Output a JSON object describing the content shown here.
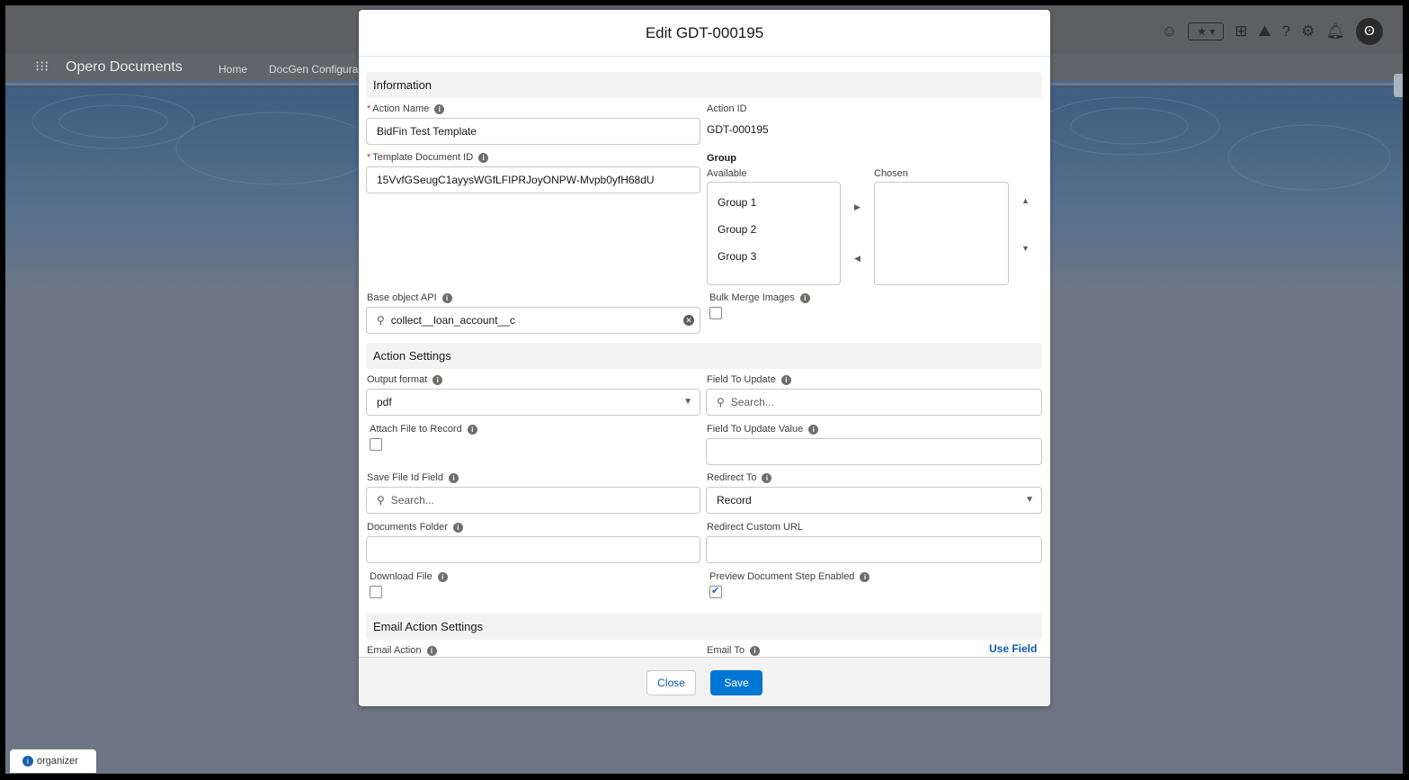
{
  "app": {
    "name": "Opero Documents",
    "nav": [
      "Home",
      "DocGen Configura"
    ]
  },
  "utility_icons": [
    "gear-face-icon",
    "favorites-icon",
    "add-icon",
    "trailhead-icon",
    "help-icon",
    "setup-icon",
    "notifications-icon",
    "avatar-icon"
  ],
  "organizer": {
    "label": "organizer"
  },
  "modal": {
    "title": "Edit GDT-000195",
    "sections": {
      "information": "Information",
      "action_settings": "Action Settings",
      "email_action_settings": "Email Action Settings"
    },
    "fields": {
      "action_name": {
        "label": "Action Name",
        "value": "BidFin Test Template"
      },
      "action_id": {
        "label": "Action ID",
        "value": "GDT-000195"
      },
      "template_document_id": {
        "label": "Template Document ID",
        "value": "15VvfGSeugC1ayysWGfLFIPRJoyONPW-Mvpb0yfH68dU"
      },
      "group": {
        "label": "Group",
        "available_label": "Available",
        "chosen_label": "Chosen",
        "available": [
          "Group 1",
          "Group 2",
          "Group 3"
        ],
        "chosen": []
      },
      "base_object_api": {
        "label": "Base object API",
        "value": "collect__loan_account__c"
      },
      "bulk_merge_images": {
        "label": "Bulk Merge Images",
        "checked": false
      },
      "output_format": {
        "label": "Output format",
        "value": "pdf"
      },
      "field_to_update": {
        "label": "Field To Update",
        "placeholder": "Search..."
      },
      "attach_file_to_record": {
        "label": "Attach File to Record",
        "checked": false
      },
      "field_to_update_value": {
        "label": "Field To Update Value",
        "value": ""
      },
      "save_file_id_field": {
        "label": "Save File Id Field",
        "placeholder": "Search..."
      },
      "redirect_to": {
        "label": "Redirect To",
        "value": "Record"
      },
      "documents_folder": {
        "label": "Documents Folder",
        "value": ""
      },
      "redirect_custom_url": {
        "label": "Redirect Custom URL",
        "value": ""
      },
      "download_file": {
        "label": "Download File",
        "checked": false
      },
      "preview_document_step_enabled": {
        "label": "Preview Document Step Enabled",
        "checked": true
      },
      "email_action": {
        "label": "Email Action"
      },
      "email_to": {
        "label": "Email To",
        "link": "Use Field"
      }
    },
    "footer": {
      "close_label": "Close",
      "save_label": "Save"
    }
  },
  "colors": {
    "brand": "#0176d3",
    "link": "#0b5cab",
    "required": "#c23934"
  }
}
